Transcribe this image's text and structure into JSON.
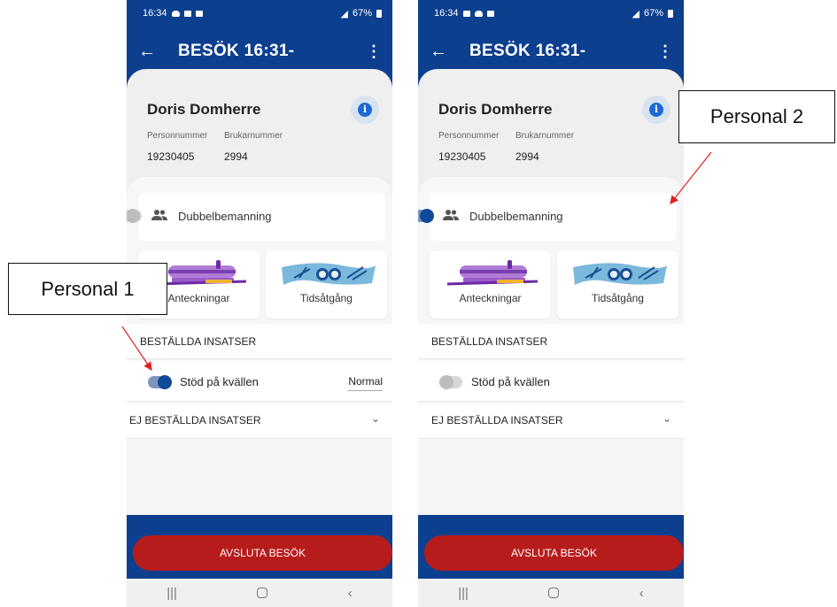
{
  "status_bar": {
    "time": "16:34",
    "battery": "67%"
  },
  "app_bar": {
    "title": "BESÖK 16:31-"
  },
  "client": {
    "name": "Doris Domherre",
    "personnummer_label": "Personnummer",
    "personnummer_value": "19230405",
    "brukarnummer_label": "Brukarnummer",
    "brukarnummer_value": "2994"
  },
  "team": {
    "label": "Dubbelbemanning"
  },
  "tiles": {
    "notes_label": "Anteckningar",
    "time_label": "Tidsåtgång"
  },
  "sections": {
    "ordered_header": "BESTÄLLDA INSATSER",
    "service_label": "Stöd på kvällen",
    "service_level": "Normal",
    "unordered_header": "EJ BESTÄLLDA INSATSER"
  },
  "end_button": "AVSLUTA BESÖK",
  "phones": [
    {
      "team_toggle": "off",
      "service_toggle": "on"
    },
    {
      "team_toggle": "on",
      "service_toggle": "off"
    }
  ],
  "callouts": {
    "personal_1": "Personal 1",
    "personal_2": "Personal 2"
  },
  "colors": {
    "header": "#0d3f8f",
    "end_button": "#b71c1c",
    "toggle_on": "#0f4a98",
    "arrow": "#e02020"
  }
}
